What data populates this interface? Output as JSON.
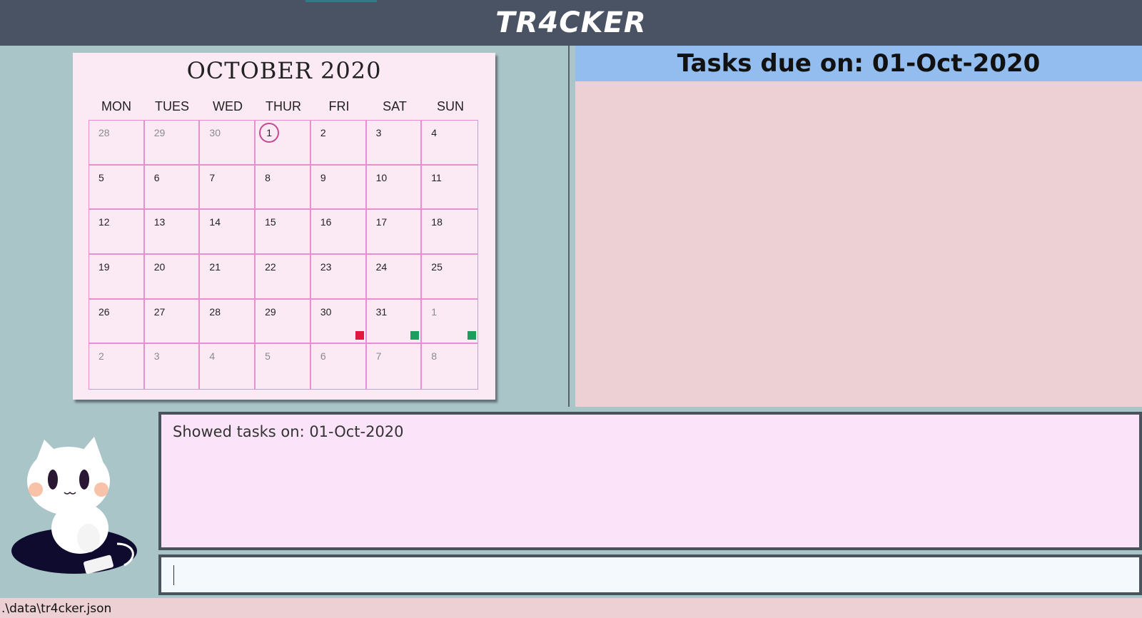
{
  "header": {
    "app_title": "TR4CKER"
  },
  "calendar": {
    "month_title": "OCTOBER 2020",
    "weekdays": [
      "MON",
      "TUES",
      "WED",
      "THUR",
      "FRI",
      "SAT",
      "SUN"
    ],
    "weeks": [
      [
        {
          "n": "28",
          "m": true
        },
        {
          "n": "29",
          "m": true
        },
        {
          "n": "30",
          "m": true
        },
        {
          "n": "1",
          "today": true
        },
        {
          "n": "2"
        },
        {
          "n": "3"
        },
        {
          "n": "4"
        }
      ],
      [
        {
          "n": "5"
        },
        {
          "n": "6"
        },
        {
          "n": "7"
        },
        {
          "n": "8"
        },
        {
          "n": "9"
        },
        {
          "n": "10"
        },
        {
          "n": "11"
        }
      ],
      [
        {
          "n": "12"
        },
        {
          "n": "13"
        },
        {
          "n": "14"
        },
        {
          "n": "15"
        },
        {
          "n": "16"
        },
        {
          "n": "17"
        },
        {
          "n": "18"
        }
      ],
      [
        {
          "n": "19"
        },
        {
          "n": "20"
        },
        {
          "n": "21"
        },
        {
          "n": "22"
        },
        {
          "n": "23"
        },
        {
          "n": "24"
        },
        {
          "n": "25"
        }
      ],
      [
        {
          "n": "26"
        },
        {
          "n": "27"
        },
        {
          "n": "28"
        },
        {
          "n": "29"
        },
        {
          "n": "30",
          "marker": "#e0173f"
        },
        {
          "n": "31",
          "marker": "#1e9e5e"
        },
        {
          "n": "1",
          "m": true,
          "marker": "#1e9e5e"
        }
      ],
      [
        {
          "n": "2",
          "m": true
        },
        {
          "n": "3",
          "m": true
        },
        {
          "n": "4",
          "m": true
        },
        {
          "n": "5",
          "m": true
        },
        {
          "n": "6",
          "m": true
        },
        {
          "n": "7",
          "m": true
        },
        {
          "n": "8",
          "m": true
        }
      ]
    ]
  },
  "tasks": {
    "title": "Tasks due on: 01-Oct-2020"
  },
  "result": {
    "text": "Showed tasks on: 01-Oct-2020"
  },
  "command": {
    "value": "",
    "placeholder": ""
  },
  "status": {
    "path": ".\\data\\tr4cker.json"
  },
  "colors": {
    "topbar": "#4a5363",
    "tasks_header": "#92bdee",
    "deadline_overdue": "#e0173f",
    "deadline_done": "#1e9e5e",
    "today_ring": "#c54a92"
  },
  "icons": {
    "mascot": "cat-mascot-icon"
  }
}
